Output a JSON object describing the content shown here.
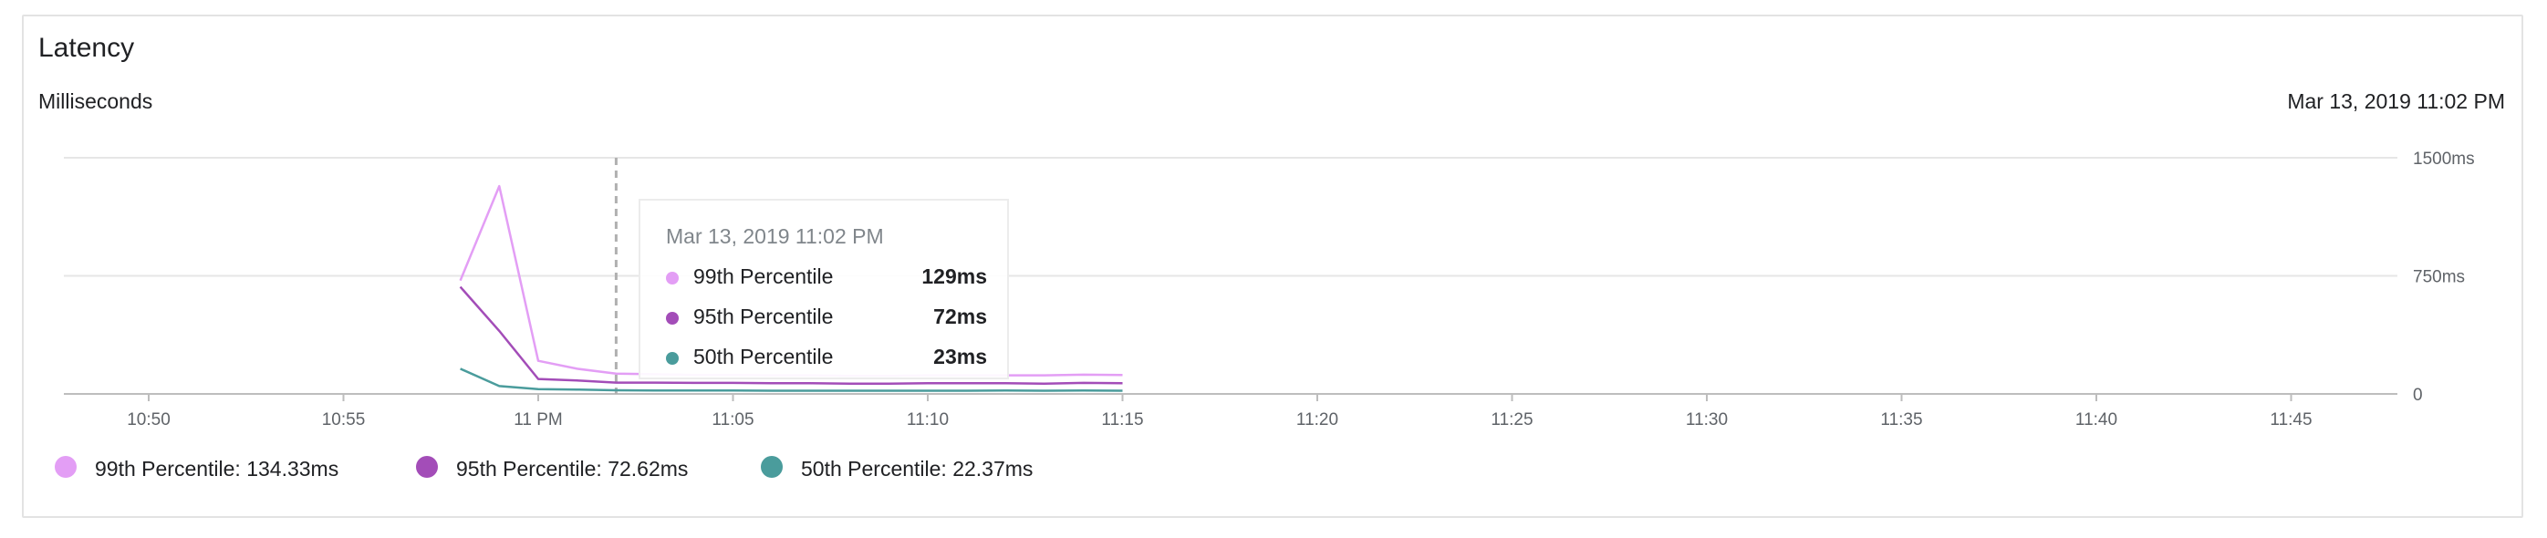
{
  "card": {
    "title": "Latency",
    "subtitle": "Milliseconds",
    "timestamp": "Mar 13, 2019 11:02 PM"
  },
  "tooltip": {
    "date": "Mar 13, 2019 11:02 PM",
    "rows": [
      {
        "label": "99th Percentile",
        "value": "129ms",
        "color": "#e39ef5"
      },
      {
        "label": "95th Percentile",
        "value": "72ms",
        "color": "#a34db8"
      },
      {
        "label": "50th Percentile",
        "value": "23ms",
        "color": "#4a9c9c"
      }
    ]
  },
  "legend": [
    {
      "label": "99th Percentile: 134.33ms",
      "color": "#e39ef5"
    },
    {
      "label": "95th Percentile: 72.62ms",
      "color": "#a34db8"
    },
    {
      "label": "50th Percentile: 22.37ms",
      "color": "#4a9c9c"
    }
  ],
  "chart_data": {
    "type": "line",
    "title": "Latency",
    "ylabel": "Milliseconds",
    "ylim": [
      0,
      1500
    ],
    "y_ticks": [
      0,
      750,
      1500
    ],
    "y_tick_labels": [
      "0",
      "750ms",
      "1500ms"
    ],
    "xlim": [
      "10:48",
      "11:48"
    ],
    "x_ticks": [
      "10:50",
      "10:55",
      "11:00",
      "11:05",
      "11:10",
      "11:15",
      "11:20",
      "11:25",
      "11:30",
      "11:35",
      "11:40",
      "11:45"
    ],
    "x_tick_labels": [
      "10:50",
      "10:55",
      "11 PM",
      "11:05",
      "11:10",
      "11:15",
      "11:20",
      "11:25",
      "11:30",
      "11:35",
      "11:40",
      "11:45"
    ],
    "cursor_x": "11:02",
    "grid": true,
    "legend_position": "bottom-left",
    "x": [
      "10:58",
      "10:59",
      "11:00",
      "11:01",
      "11:02",
      "11:03",
      "11:04",
      "11:05",
      "11:06",
      "11:07",
      "11:08",
      "11:09",
      "11:10",
      "11:11",
      "11:12",
      "11:13",
      "11:14",
      "11:15"
    ],
    "series": [
      {
        "name": "99th Percentile",
        "color": "#e39ef5",
        "values": [
          720,
          1320,
          210,
          160,
          129,
          125,
          120,
          120,
          118,
          118,
          115,
          115,
          118,
          118,
          118,
          118,
          122,
          120
        ]
      },
      {
        "name": "95th Percentile",
        "color": "#a34db8",
        "values": [
          680,
          400,
          95,
          85,
          72,
          72,
          70,
          70,
          68,
          68,
          65,
          65,
          68,
          68,
          68,
          65,
          70,
          68
        ]
      },
      {
        "name": "50th Percentile",
        "color": "#4a9c9c",
        "values": [
          160,
          50,
          30,
          28,
          23,
          22,
          22,
          22,
          20,
          20,
          20,
          20,
          20,
          20,
          22,
          20,
          22,
          20
        ]
      }
    ]
  }
}
